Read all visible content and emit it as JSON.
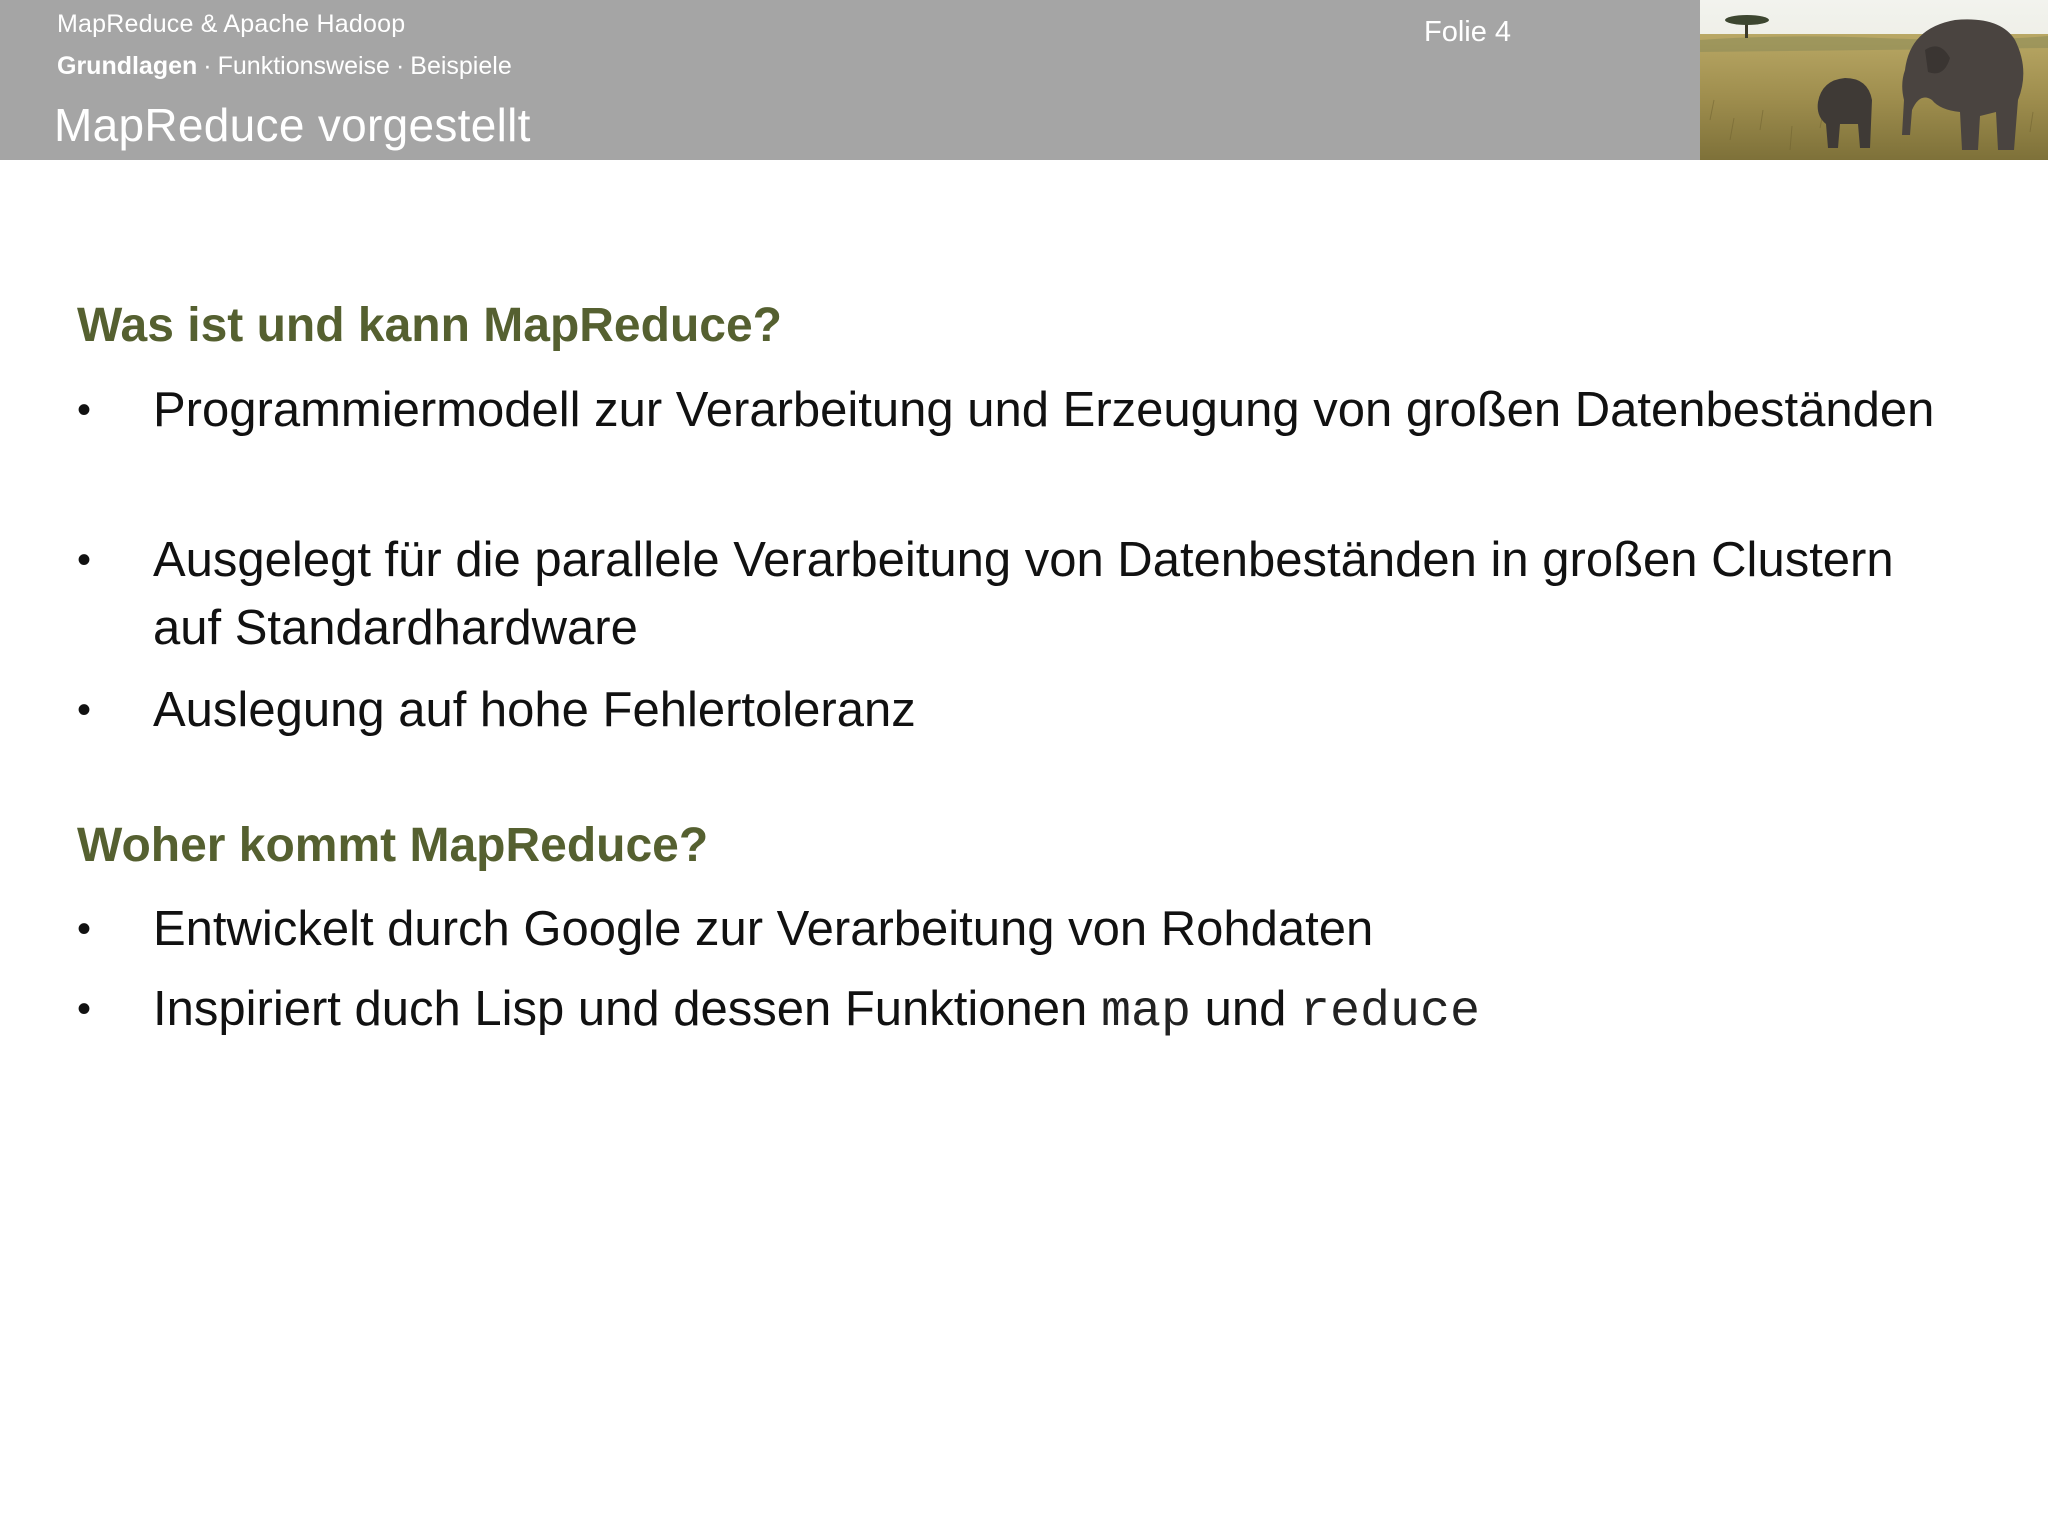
{
  "header": {
    "course_title": "MapReduce & Apache Hadoop",
    "nav": {
      "active": "Grundlagen",
      "separator": "·",
      "items": [
        "Funktionsweise",
        "Beispiele"
      ]
    },
    "slide_title": "MapReduce vorgestellt",
    "slide_number": "Folie 4",
    "photo_icon": "elephants-savanna-photo"
  },
  "content": {
    "section1": {
      "title": "Was ist und kann MapReduce?",
      "bullets": [
        "Programmiermodell zur Verarbeitung und Erzeugung von großen Datenbeständen",
        "Ausgelegt für die parallele Verarbeitung von Datenbeständen in großen Clustern auf Standardhardware",
        "Auslegung auf hohe Fehlertoleranz"
      ]
    },
    "section2": {
      "title": "Woher kommt MapReduce?",
      "bullet1": "Entwickelt durch Google zur Verarbeitung von Rohdaten",
      "bullet2": {
        "prefix": "Inspiriert duch Lisp und dessen Funktionen",
        "code1": "map",
        "middle": "und",
        "code2": "reduce"
      }
    },
    "bullet_symbol": "•"
  },
  "colors": {
    "header_bg": "#a5a5a5",
    "section_title": "#556030",
    "body_text": "#111111"
  }
}
